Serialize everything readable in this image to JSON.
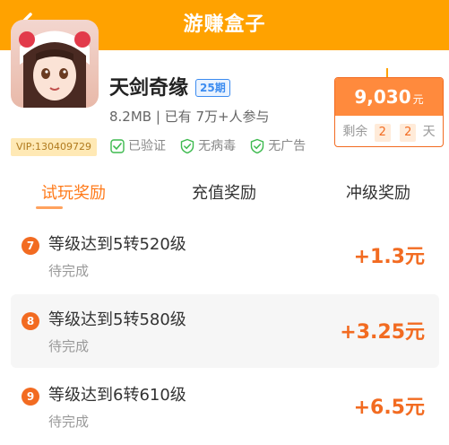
{
  "header": {
    "title": "游赚盒子",
    "back_icon": "chevron-left-icon"
  },
  "app": {
    "name": "天剑奇缘",
    "period": "25期",
    "meta": "8.2MB | 已有 7万+人参与",
    "vip_id": "VIP:130409729",
    "badges": [
      {
        "icon": "verified-seal-icon",
        "label": "已验证"
      },
      {
        "icon": "shield-check-icon",
        "label": "无病毒"
      },
      {
        "icon": "shield-check-icon",
        "label": "无广告"
      }
    ]
  },
  "reward": {
    "amount": "9,030",
    "unit": "元",
    "remaining_label": "剩余",
    "remaining_value_1": "2",
    "remaining_value_2": "2",
    "remaining_unit": "天"
  },
  "tabs": [
    {
      "label": "试玩奖励",
      "active": true
    },
    {
      "label": "充值奖励",
      "active": false
    },
    {
      "label": "冲级奖励",
      "active": false
    }
  ],
  "tasks": [
    {
      "num": "7",
      "title": "等级达到5转520级",
      "status": "待完成",
      "reward": "+1.3元"
    },
    {
      "num": "8",
      "title": "等级达到5转580级",
      "status": "待完成",
      "reward": "+3.25元"
    },
    {
      "num": "9",
      "title": "等级达到6转610级",
      "status": "待完成",
      "reward": "+6.5元"
    }
  ],
  "colors": {
    "header": "#FFA200",
    "accent": "#F26B21",
    "reward_fill": "#FF8A3D",
    "badge_blue": "#3C8CF0",
    "verify_green": "#3DBA4E"
  }
}
